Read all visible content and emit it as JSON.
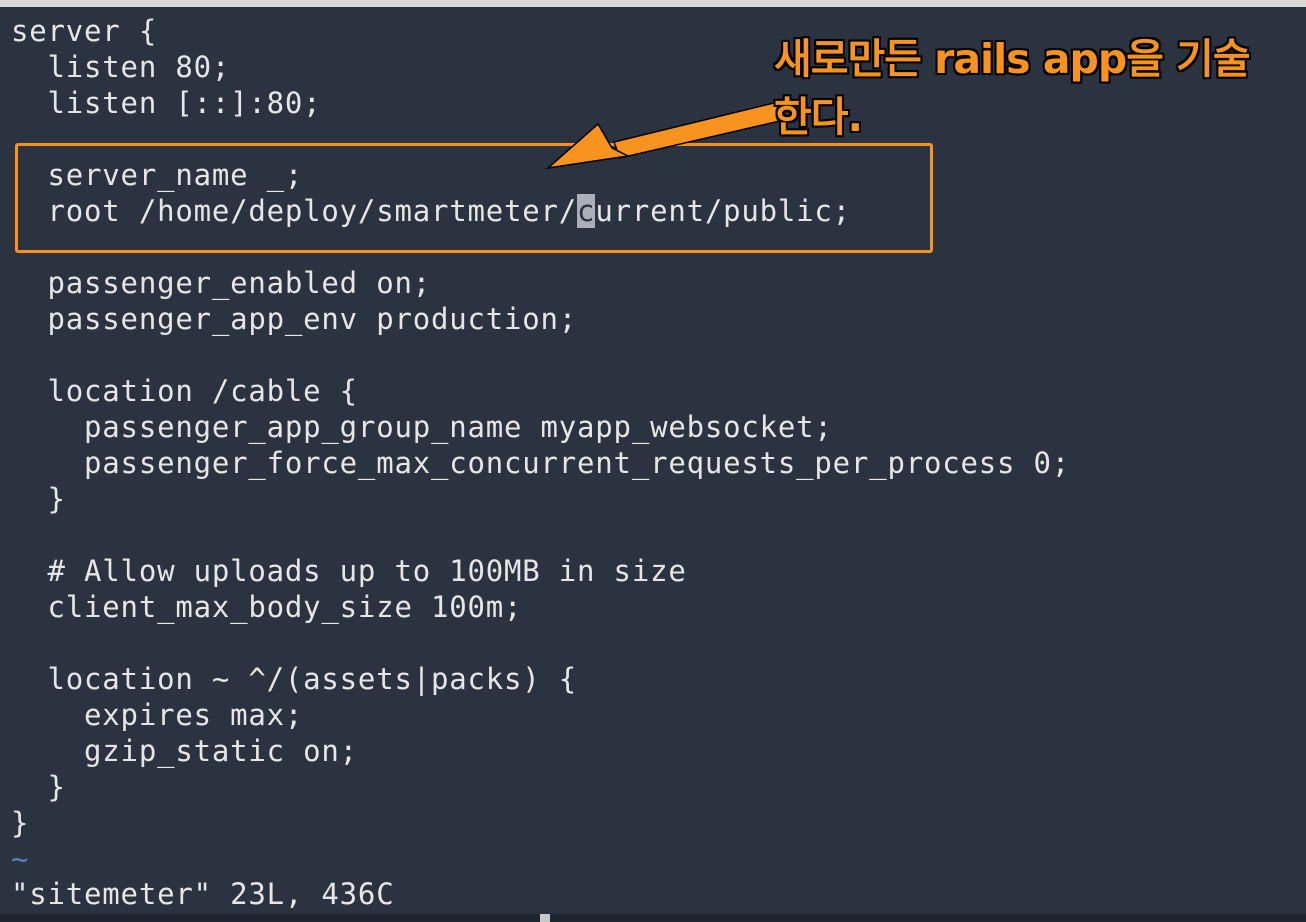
{
  "editor": {
    "lines": [
      "server {",
      "  listen 80;",
      "  listen [::]:80;",
      "",
      "  server_name _;",
      "  root /home/deploy/smartmeter/",
      "",
      "  passenger_enabled on;",
      "  passenger_app_env production;",
      "",
      "  location /cable {",
      "    passenger_app_group_name myapp_websocket;",
      "    passenger_force_max_concurrent_requests_per_process 0;",
      "  }",
      "",
      "  # Allow uploads up to 100MB in size",
      "  client_max_body_size 100m;",
      "",
      "  location ~ ^/(assets|packs) {",
      "    expires max;",
      "    gzip_static on;",
      "  }",
      "}"
    ],
    "cursor_char": "c",
    "cursor_line_rest": "urrent/public;",
    "tilde": "~"
  },
  "status": {
    "message": "\"sitemeter\" 23L, 436C"
  },
  "annotation": {
    "line1": "새로만든 rails app을 기술",
    "line2": "한다.",
    "color": "#f7931e"
  }
}
